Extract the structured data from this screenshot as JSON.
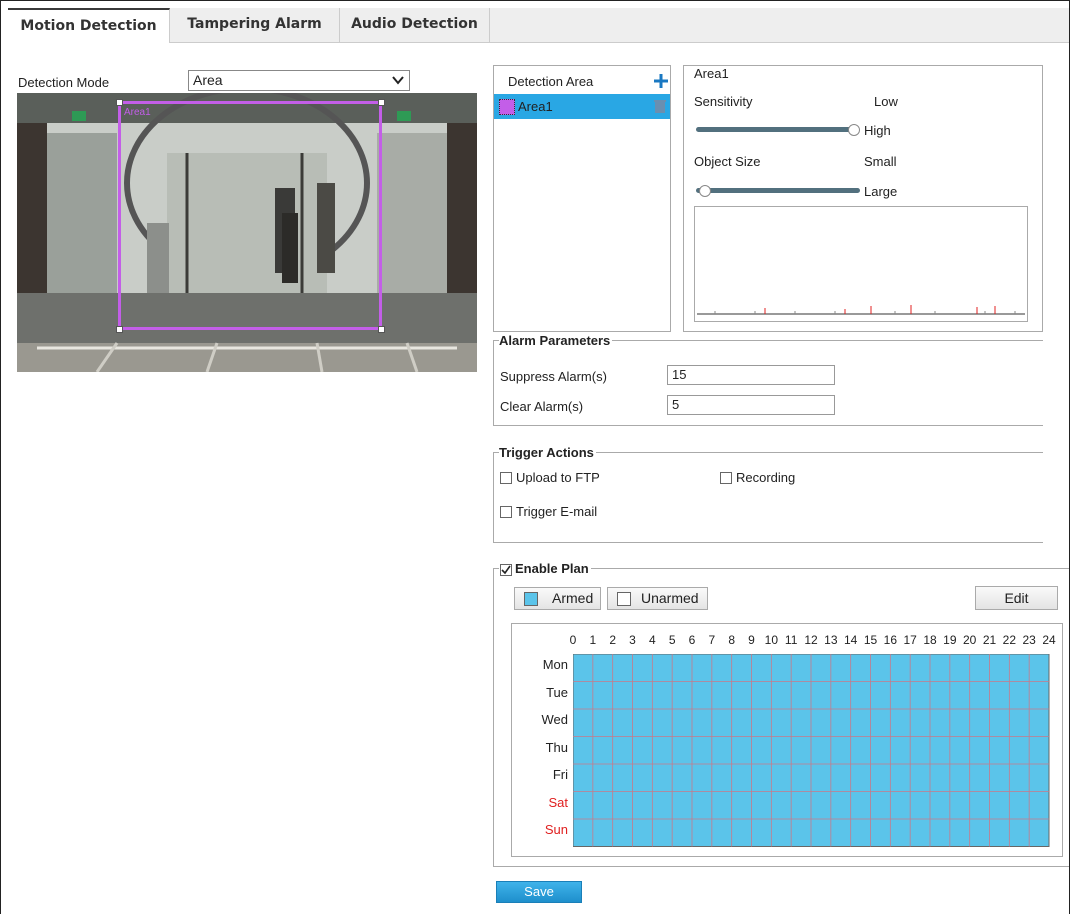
{
  "tabs": [
    "Motion Detection",
    "Tampering Alarm",
    "Audio Detection"
  ],
  "detection_mode": {
    "label": "Detection Mode",
    "value": "Area"
  },
  "video": {
    "overlay_label": "Area1"
  },
  "area_list": {
    "header": "Detection Area",
    "items": [
      "Area1"
    ]
  },
  "area_settings": {
    "title": "Area1",
    "sensitivity_label": "Sensitivity",
    "sensitivity_low": "Low",
    "sensitivity_high": "High",
    "sensitivity_level": 1.0,
    "object_size_label": "Object Size",
    "object_size_small": "Small",
    "object_size_large": "Large",
    "object_size_level": 0.0
  },
  "alarm_parameters": {
    "legend": "Alarm Parameters",
    "suppress_label": "Suppress Alarm(s)",
    "suppress_value": "15",
    "clear_label": "Clear Alarm(s)",
    "clear_value": "5"
  },
  "trigger_actions": {
    "legend": "Trigger Actions",
    "upload_ftp": "Upload to FTP",
    "recording": "Recording",
    "trigger_email": "Trigger E-mail"
  },
  "plan": {
    "legend": "Enable Plan",
    "armed_label": "Armed",
    "unarmed_label": "Unarmed",
    "edit_label": "Edit",
    "hours": [
      "0",
      "1",
      "2",
      "3",
      "4",
      "5",
      "6",
      "7",
      "8",
      "9",
      "10",
      "11",
      "12",
      "13",
      "14",
      "15",
      "16",
      "17",
      "18",
      "19",
      "20",
      "21",
      "22",
      "23",
      "24"
    ],
    "days": [
      "Mon",
      "Tue",
      "Wed",
      "Thu",
      "Fri",
      "Sat",
      "Sun"
    ],
    "weekend_color": "#e02020",
    "armed_color": "#5bc4ea"
  },
  "save_label": "Save"
}
